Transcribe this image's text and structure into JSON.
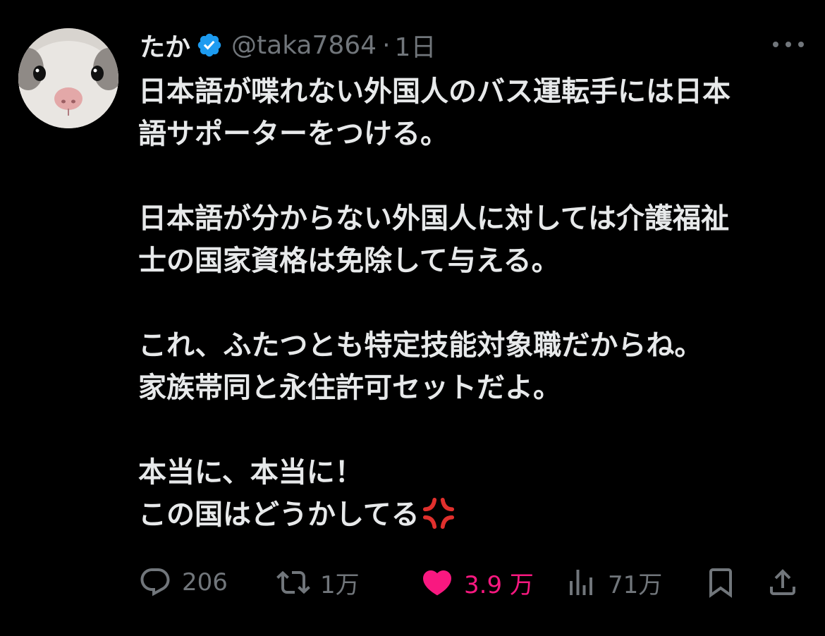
{
  "post": {
    "author": {
      "name": "たか",
      "handle": "@taka7864",
      "verified": true,
      "avatar": "cat-face-avatar"
    },
    "separator": "·",
    "time": "1日",
    "text": {
      "p1": [
        "日本語が喋れない外国人のバス運転手には日本",
        "語サポーターをつける。"
      ],
      "p2": [
        "日本語が分からない外国人に対しては介護福祉",
        "士の国家資格は免除して与える。"
      ],
      "p3": [
        "これ、ふたつとも特定技能対象職だからね。",
        "家族帯同と永住許可セットだよ。"
      ],
      "p4": [
        "本当に、本当に！",
        "この国はどうかしてる"
      ],
      "emoji": "anger-symbol-emoji"
    },
    "actions": {
      "reply": {
        "icon": "reply-icon",
        "count": "206"
      },
      "retweet": {
        "icon": "retweet-icon",
        "count": "1万"
      },
      "like": {
        "icon": "heart-icon",
        "count": "3.9 万",
        "liked": true
      },
      "views": {
        "icon": "views-icon",
        "count": "71万"
      },
      "bookmark": {
        "icon": "bookmark-icon"
      },
      "share": {
        "icon": "share-icon"
      }
    }
  },
  "colors": {
    "background": "#000000",
    "text": "#e7e9ea",
    "secondary": "#71767b",
    "verified": "#1d9bf0",
    "like": "#f91880"
  }
}
